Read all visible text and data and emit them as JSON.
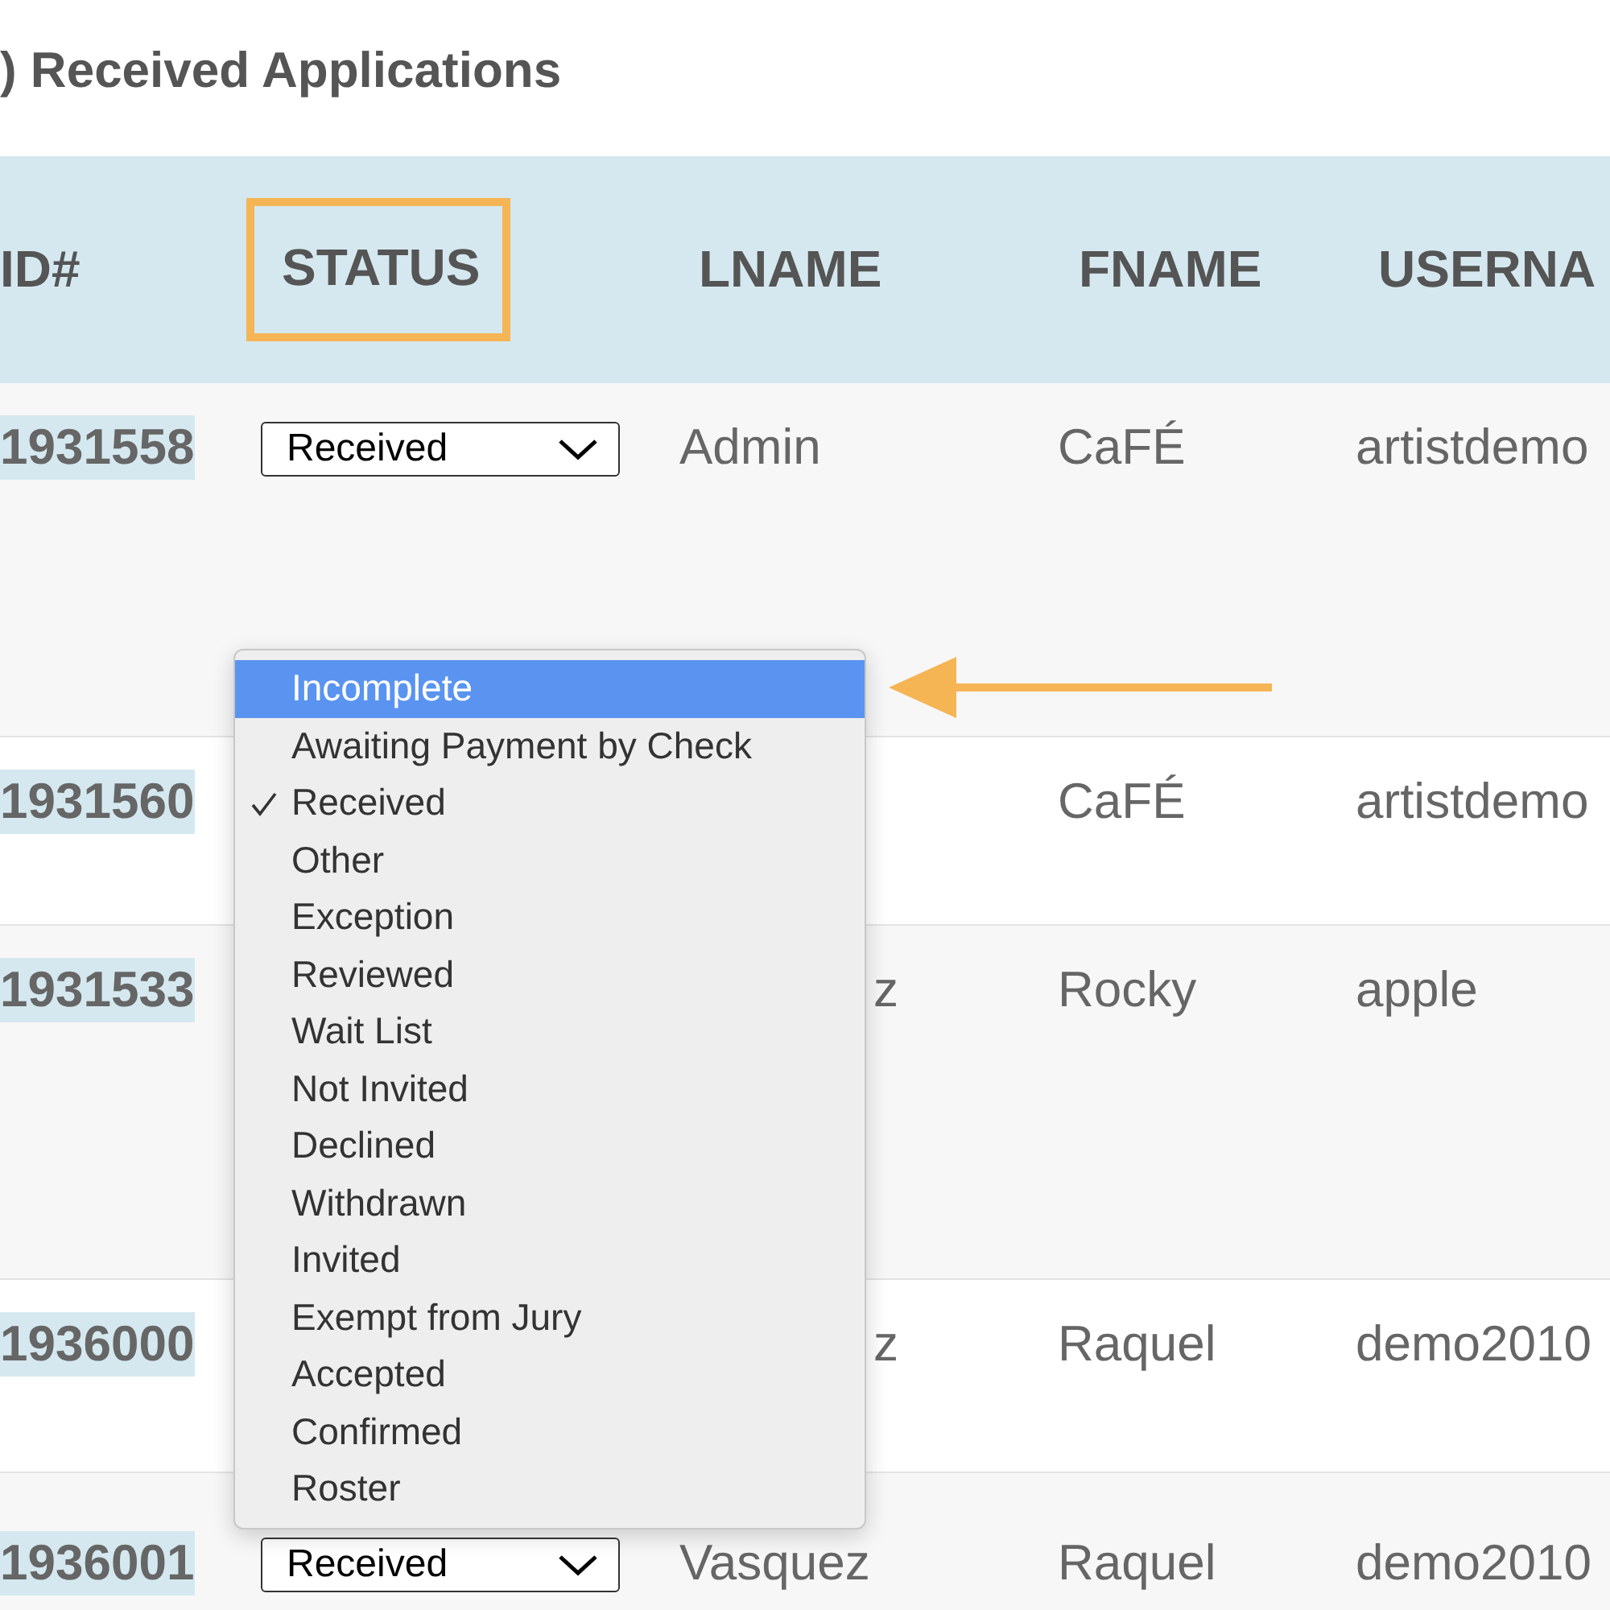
{
  "heading": ") Received Applications",
  "table": {
    "columns": [
      {
        "label": "ID#",
        "highlighted": false
      },
      {
        "label": "STATUS",
        "highlighted": true
      },
      {
        "label": "LNAME",
        "highlighted": false
      },
      {
        "label": "FNAME",
        "highlighted": false
      },
      {
        "label": "USERNA",
        "highlighted": false
      }
    ],
    "rows": [
      {
        "id": "1931558",
        "status": "Received",
        "lname": "Admin",
        "lname_clipped": false,
        "fname": "CaFÉ",
        "username": "artistdemo"
      },
      {
        "id": "1931560",
        "fname": "CaFÉ",
        "username": "artistdemo"
      },
      {
        "id": "1931533",
        "lname": "z",
        "lname_clipped": true,
        "fname": "Rocky",
        "username": "apple"
      },
      {
        "id": "1936000",
        "lname": "z",
        "lname_clipped": true,
        "fname": "Raquel",
        "username": "demo2010"
      },
      {
        "id": "1936001",
        "status": "Received",
        "lname": "Vasquez",
        "lname_clipped": false,
        "fname": "Raquel",
        "username": "demo2010"
      }
    ]
  },
  "dropdown": {
    "options": [
      {
        "label": "Incomplete",
        "highlighted": true,
        "checked": false
      },
      {
        "label": "Awaiting Payment by Check",
        "highlighted": false,
        "checked": false
      },
      {
        "label": "Received",
        "highlighted": false,
        "checked": true
      },
      {
        "label": "Other",
        "highlighted": false,
        "checked": false
      },
      {
        "label": "Exception",
        "highlighted": false,
        "checked": false
      },
      {
        "label": "Reviewed",
        "highlighted": false,
        "checked": false
      },
      {
        "label": "Wait List",
        "highlighted": false,
        "checked": false
      },
      {
        "label": "Not Invited",
        "highlighted": false,
        "checked": false
      },
      {
        "label": "Declined",
        "highlighted": false,
        "checked": false
      },
      {
        "label": "Withdrawn",
        "highlighted": false,
        "checked": false
      },
      {
        "label": "Invited",
        "highlighted": false,
        "checked": false
      },
      {
        "label": "Exempt from Jury",
        "highlighted": false,
        "checked": false
      },
      {
        "label": "Accepted",
        "highlighted": false,
        "checked": false
      },
      {
        "label": "Confirmed",
        "highlighted": false,
        "checked": false
      },
      {
        "label": "Roster",
        "highlighted": false,
        "checked": false
      }
    ]
  }
}
